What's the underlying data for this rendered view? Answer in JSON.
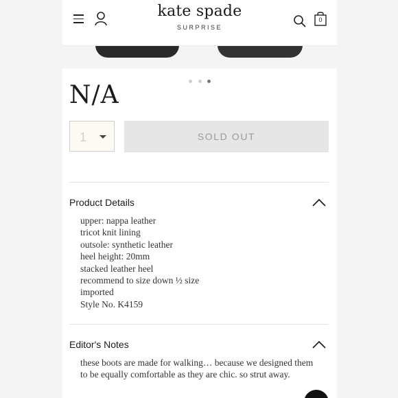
{
  "header": {
    "brand": "kate spade",
    "brand_sub": "SURPRISE",
    "bag_count": "0",
    "icons": [
      "menu-icon",
      "user-icon",
      "search-icon",
      "shopping-bag-icon"
    ]
  },
  "carousel": {
    "total": 3,
    "active": 3
  },
  "product": {
    "price": "N/A",
    "quantity": "1",
    "sold_out_label": "SOLD OUT"
  },
  "product_details": {
    "title": "Product Details",
    "items": [
      "upper: nappa leather",
      "tricot knit lining",
      "outsole: synthetic leather",
      "heel height: 20mm",
      "stacked leather heel",
      "recommend to size down ½ size",
      "imported",
      "Style No. K4159"
    ]
  },
  "editors_notes": {
    "title": "Editor's Notes",
    "text": "these boots are made for walking… because we designed them to be equally comfortable as they are chic. so strut away."
  },
  "colors": {
    "sold_out_bg": "#e6e6e6",
    "sold_out_text": "#9a9a9a",
    "background": "#f4f4f4"
  }
}
